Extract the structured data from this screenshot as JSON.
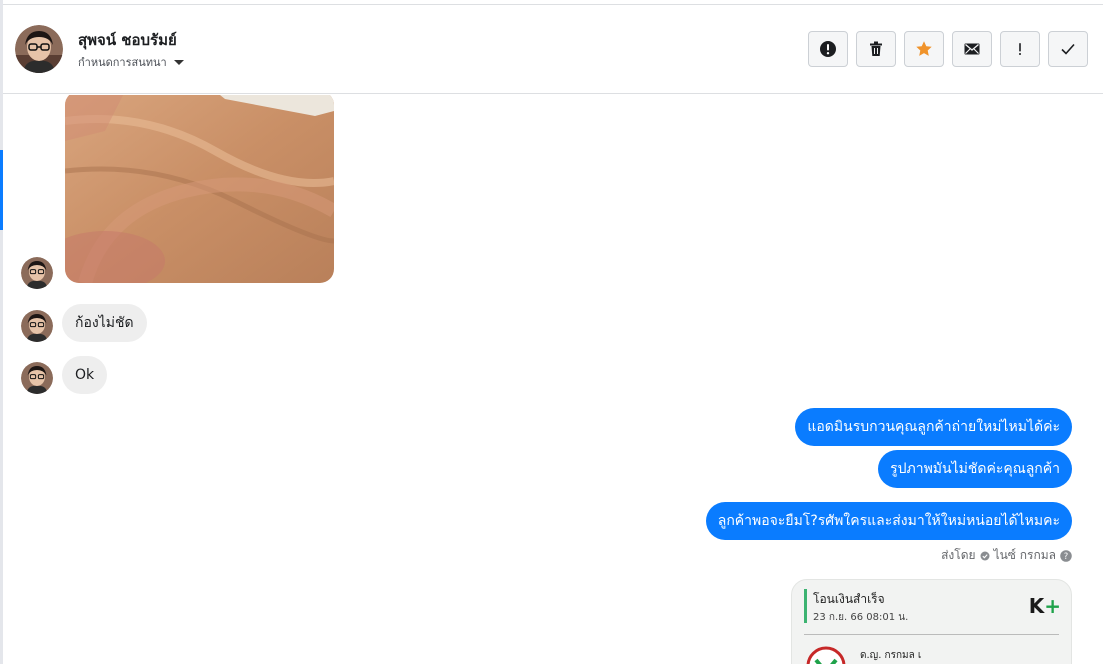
{
  "conversation": {
    "contact_name": "สุพจน์ ชอบรัมย์",
    "assign_label": "กำหนดการสนทนา"
  },
  "toolbar": {
    "buttons": [
      {
        "name": "report",
        "icon": "alert-circle-icon"
      },
      {
        "name": "delete",
        "icon": "trash-icon"
      },
      {
        "name": "star",
        "icon": "star-icon",
        "color": "#f0932b"
      },
      {
        "name": "mark-unread",
        "icon": "envelope-icon"
      },
      {
        "name": "important",
        "icon": "exclamation-icon"
      },
      {
        "name": "done",
        "icon": "checkmark-icon"
      }
    ]
  },
  "messages": {
    "incoming": [
      {
        "type": "image",
        "description_icon": "photo"
      },
      {
        "type": "text",
        "text": "ก้องไม่ชัด"
      },
      {
        "type": "text",
        "text": "Ok"
      }
    ],
    "outgoing": [
      {
        "text": "แอดมินรบกวนคุณลูกค้าถ่ายใหม่ไหมได้ค่ะ"
      },
      {
        "text": "รูปภาพมันไม่ชัดค่ะคุณลูกค้า"
      },
      {
        "text": "ลูกค้าพอจะยืมโ?รศัพใครและส่งมาให้ใหม่หน่อยได้ไหมคะ"
      }
    ],
    "sent_by_prefix": "ส่งโดย",
    "sent_by_name": "ไนซ์ กรกมล"
  },
  "receipt": {
    "title": "โอนเงินสำเร็จ",
    "datetime": "23 ก.ย. 66  08:01 น.",
    "logo_k": "K",
    "logo_plus": "+",
    "payee": "ด.ญ. กรกมล เ"
  },
  "colors": {
    "outgoing_bubble": "#0a7cff",
    "incoming_bubble": "#eeeeee",
    "star": "#f0932b",
    "kplus_green": "#1fa24a"
  }
}
